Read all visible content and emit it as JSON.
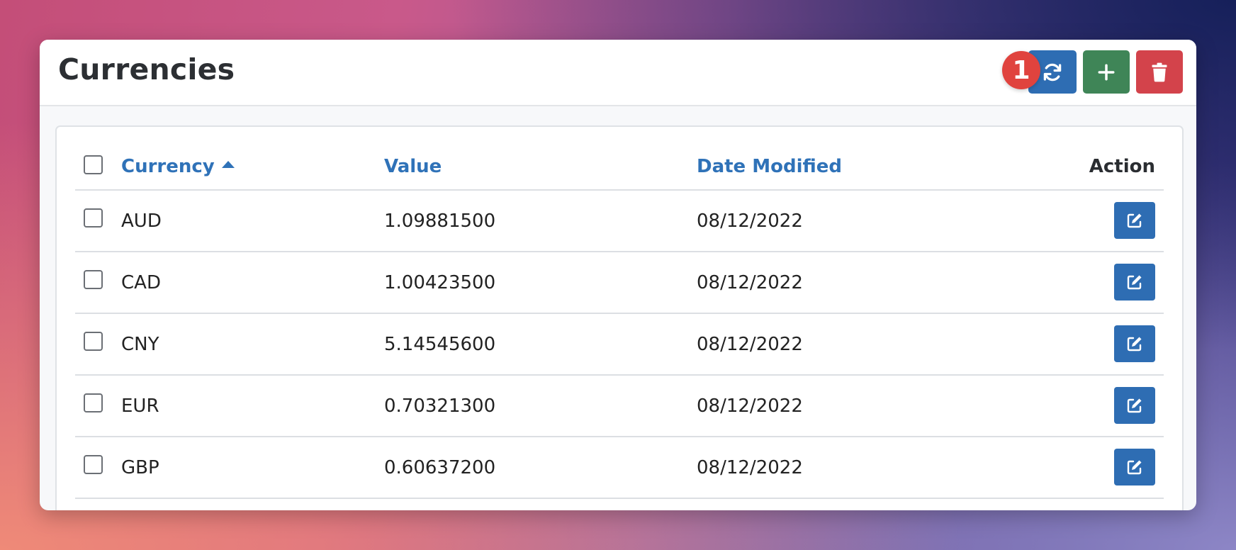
{
  "page": {
    "title": "Currencies",
    "badge": "1"
  },
  "toolbar": {
    "refresh_icon": "refresh-icon",
    "add_icon": "plus-icon",
    "delete_icon": "trash-icon",
    "colors": {
      "refresh": "#2e6db3",
      "add": "#3f8557",
      "delete": "#d3434b"
    }
  },
  "table": {
    "columns": {
      "currency": "Currency",
      "value": "Value",
      "date_modified": "Date Modified",
      "action": "Action"
    },
    "sort": {
      "column": "currency",
      "direction": "ascending"
    },
    "rows": [
      {
        "currency": "AUD",
        "value": "1.09881500",
        "date_modified": "08/12/2022"
      },
      {
        "currency": "CAD",
        "value": "1.00423500",
        "date_modified": "08/12/2022"
      },
      {
        "currency": "CNY",
        "value": "5.14545600",
        "date_modified": "08/12/2022"
      },
      {
        "currency": "EUR",
        "value": "0.70321300",
        "date_modified": "08/12/2022"
      },
      {
        "currency": "GBP",
        "value": "0.60637200",
        "date_modified": "08/12/2022"
      }
    ]
  }
}
